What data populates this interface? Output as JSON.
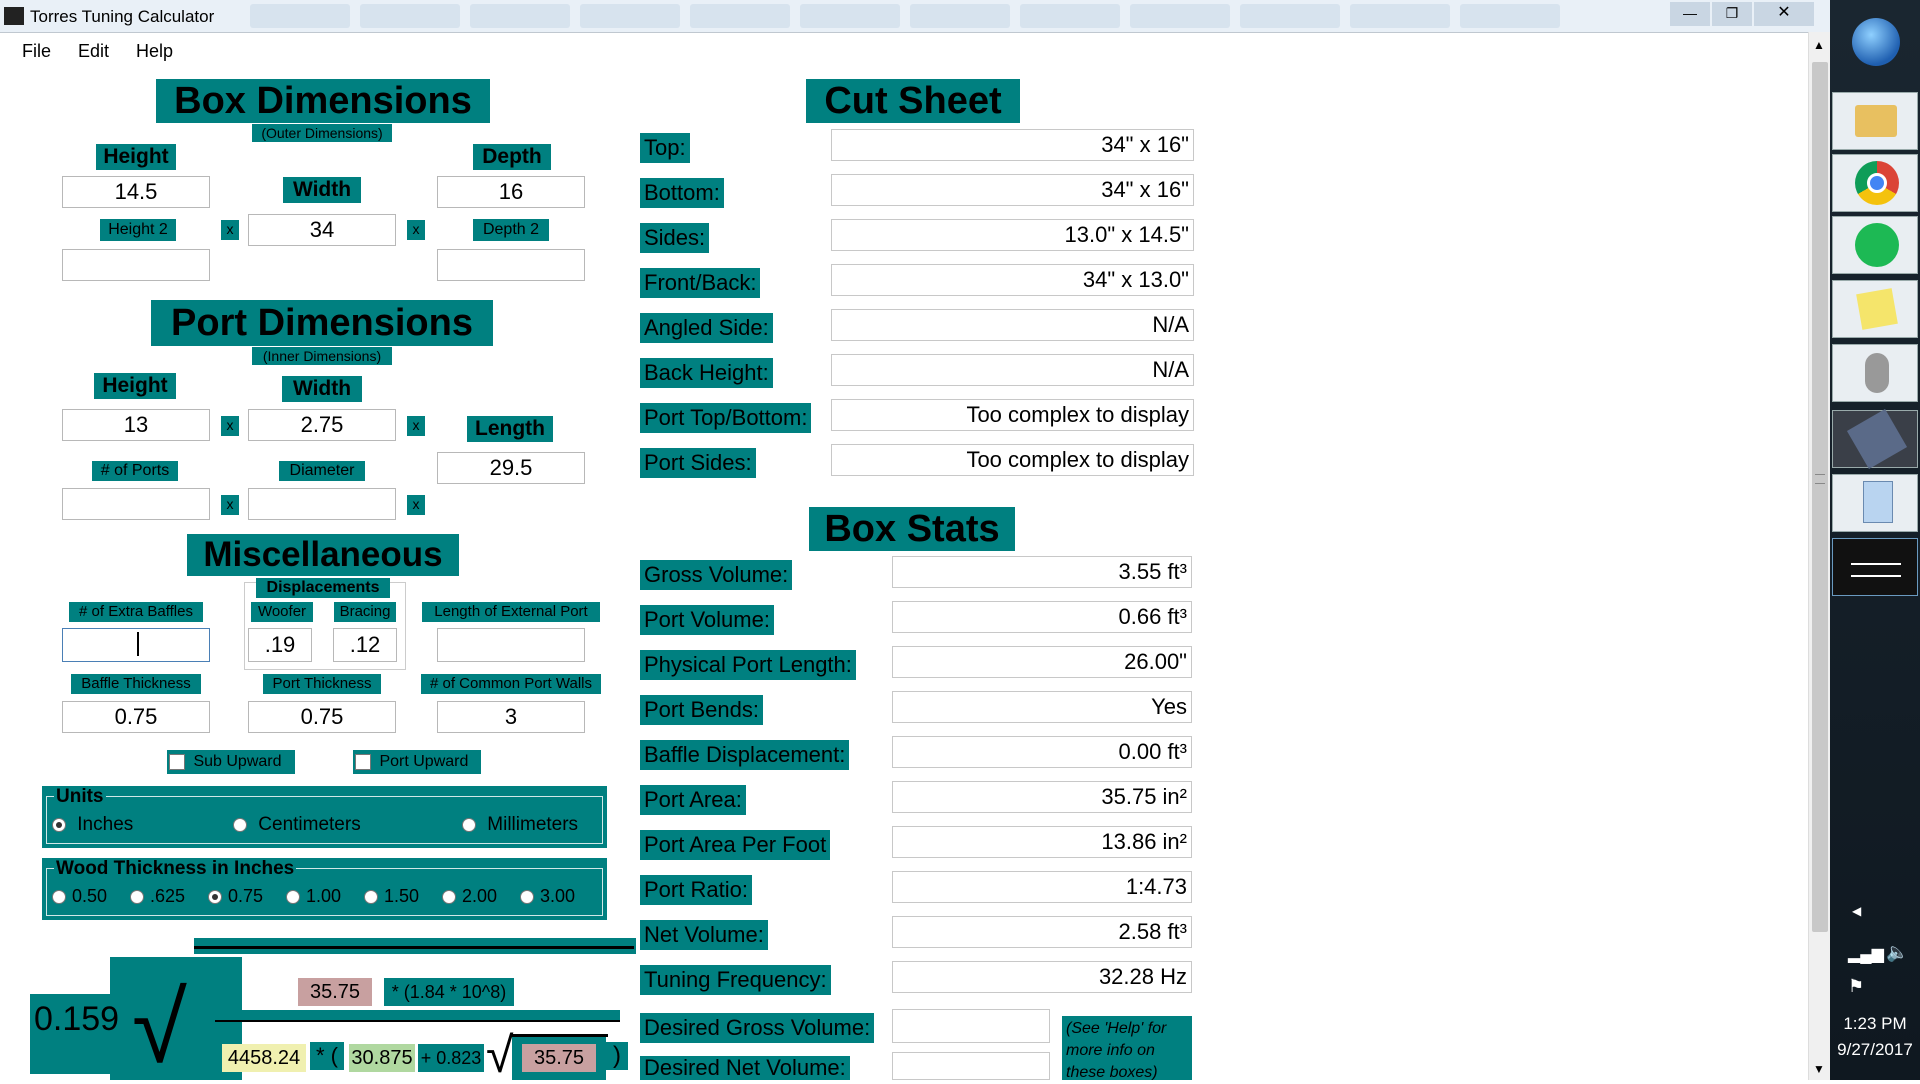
{
  "window": {
    "title": "Torres Tuning Calculator",
    "minimize": "—",
    "maximize": "❐",
    "close": "✕"
  },
  "menu": {
    "file": "File",
    "edit": "Edit",
    "help": "Help"
  },
  "box_dims": {
    "title": "Box Dimensions",
    "subtitle": "(Outer Dimensions)",
    "height_label": "Height",
    "height": "14.5",
    "width_label": "Width",
    "width": "34",
    "depth_label": "Depth",
    "depth": "16",
    "height2_label": "Height 2",
    "height2": "",
    "depth2_label": "Depth 2",
    "depth2": "",
    "x": "x"
  },
  "port_dims": {
    "title": "Port Dimensions",
    "subtitle": "(Inner Dimensions)",
    "height_label": "Height",
    "height": "13",
    "width_label": "Width",
    "width": "2.75",
    "length_label": "Length",
    "length": "29.5",
    "ports_label": "# of Ports",
    "ports": "",
    "diameter_label": "Diameter",
    "diameter": ""
  },
  "misc": {
    "title": "Miscellaneous",
    "displacements_label": "Displacements",
    "extra_baffles_label": "# of Extra Baffles",
    "extra_baffles": "",
    "woofer_label": "Woofer",
    "woofer": ".19",
    "bracing_label": "Bracing",
    "bracing": ".12",
    "ext_port_label": "Length of External Port",
    "ext_port": "",
    "baffle_thick_label": "Baffle Thickness",
    "baffle_thick": "0.75",
    "port_thick_label": "Port Thickness",
    "port_thick": "0.75",
    "common_walls_label": "# of Common Port Walls",
    "common_walls": "3",
    "sub_upward": "Sub Upward",
    "port_upward": "Port Upward"
  },
  "units": {
    "title": "Units",
    "inches": "Inches",
    "cm": "Centimeters",
    "mm": "Millimeters",
    "selected": "inches"
  },
  "wood": {
    "title": "Wood Thickness in Inches",
    "options": [
      "0.50",
      ".625",
      "0.75",
      "1.00",
      "1.50",
      "2.00",
      "3.00"
    ],
    "selected": "0.75"
  },
  "formula": {
    "coef": "0.159",
    "port_area": "35.75",
    "constant": "* (1.84 * 10^8)",
    "v": "4458.24",
    "star_paren": "* (",
    "length": "30.875",
    "plus": "+ 0.823",
    "area2": "35.75",
    "close_paren": ")"
  },
  "cut_sheet": {
    "title": "Cut Sheet",
    "rows": [
      {
        "label": "Top:",
        "value": "34\" x 16\""
      },
      {
        "label": "Bottom:",
        "value": "34\" x 16\""
      },
      {
        "label": "Sides:",
        "value": "13.0\" x 14.5\""
      },
      {
        "label": "Front/Back:",
        "value": "34\" x 13.0\""
      },
      {
        "label": "Angled Side:",
        "value": "N/A"
      },
      {
        "label": "Back Height:",
        "value": "N/A"
      },
      {
        "label": "Port Top/Bottom:",
        "value": "Too complex to display"
      },
      {
        "label": "Port Sides:",
        "value": "Too complex to display"
      }
    ]
  },
  "box_stats": {
    "title": "Box Stats",
    "rows": [
      {
        "label": "Gross Volume:",
        "value": "3.55 ft³"
      },
      {
        "label": "Port Volume:",
        "value": "0.66 ft³"
      },
      {
        "label": "Physical Port Length:",
        "value": "26.00\""
      },
      {
        "label": "Port Bends:",
        "value": "Yes"
      },
      {
        "label": "Baffle Displacement:",
        "value": "0.00 ft³"
      },
      {
        "label": "Port Area:",
        "value": "35.75 in²"
      },
      {
        "label": "Port Area Per Foot",
        "value": "13.86 in²"
      },
      {
        "label": "Port Ratio:",
        "value": "1:4.73"
      },
      {
        "label": "Net Volume:",
        "value": "2.58 ft³"
      },
      {
        "label": "Tuning Frequency:",
        "value": "32.28 Hz"
      }
    ],
    "desired_gross_label": "Desired Gross Volume:",
    "desired_net_label": "Desired Net Volume:",
    "help_note": "(See 'Help' for more info on these boxes)"
  },
  "tray": {
    "time": "1:23 PM",
    "date": "9/27/2017"
  },
  "colors": {
    "teal": "#008080",
    "pink": "#c8a0a0",
    "yellow": "#f0f0b0",
    "green": "#b0d8a0"
  }
}
